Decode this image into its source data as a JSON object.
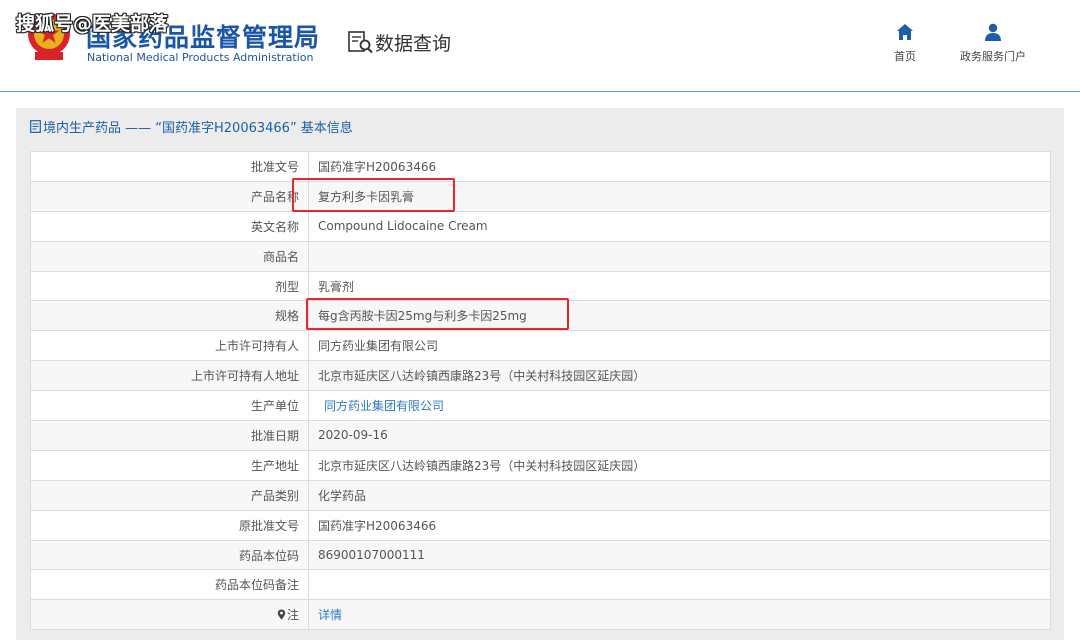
{
  "header": {
    "watermark": "搜狐号@医美部落",
    "site_title": "国家药品监督管理局",
    "site_subtitle": "National Medical Products Administration",
    "query_label": "数据查询",
    "nav": [
      {
        "label": "首页",
        "icon": "home-icon"
      },
      {
        "label": "政务服务门户",
        "icon": "user-icon"
      }
    ]
  },
  "panel": {
    "title": "境内生产药品 ——  “国药准字H20063466” 基本信息",
    "rows": [
      {
        "label": "批准文号",
        "value": "国药准字H20063466"
      },
      {
        "label": "产品名称",
        "value": "复方利多卡因乳膏"
      },
      {
        "label": "英文名称",
        "value": "Compound Lidocaine Cream"
      },
      {
        "label": "商品名",
        "value": ""
      },
      {
        "label": "剂型",
        "value": "乳膏剂"
      },
      {
        "label": "规格",
        "value": "每g含丙胺卡因25mg与利多卡因25mg"
      },
      {
        "label": "上市许可持有人",
        "value": "同方药业集团有限公司"
      },
      {
        "label": "上市许可持有人地址",
        "value": "北京市延庆区八达岭镇西康路23号（中关村科技园区延庆园）"
      },
      {
        "label": "生产单位",
        "value": "同方药业集团有限公司"
      },
      {
        "label": "批准日期",
        "value": "2020-09-16"
      },
      {
        "label": "生产地址",
        "value": "北京市延庆区八达岭镇西康路23号（中关村科技园区延庆园）"
      },
      {
        "label": "产品类别",
        "value": "化学药品"
      },
      {
        "label": "原批准文号",
        "value": "国药准字H20063466"
      },
      {
        "label": "药品本位码",
        "value": "86900107000111"
      },
      {
        "label": "药品本位码备注",
        "value": ""
      },
      {
        "label": "注",
        "value": "详情"
      }
    ]
  },
  "colors": {
    "brand_blue": "#1a56a8",
    "link_blue": "#2f79c6",
    "highlight_red": "#e8262d",
    "panel_gray": "#ececec"
  }
}
